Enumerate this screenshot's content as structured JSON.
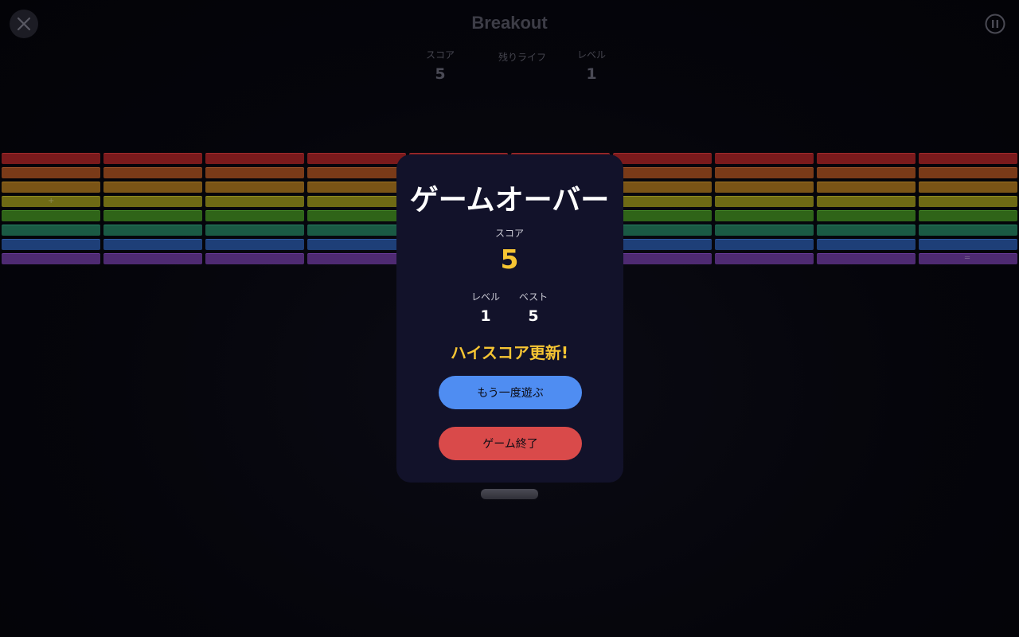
{
  "header": {
    "title": "Breakout",
    "close_icon": "close-icon",
    "pause_icon": "pause-icon"
  },
  "stats": {
    "score_label": "スコア",
    "score_value": "5",
    "lives_label": "残りライフ",
    "level_label": "レベル",
    "level_value": "1"
  },
  "bricks": {
    "columns": 10,
    "row_colors": [
      "#7a1a1c",
      "#7a3a18",
      "#7a5416",
      "#6e6a14",
      "#2f6418",
      "#1a5a44",
      "#1e3f78",
      "#4e2a72"
    ],
    "row_borders": [
      "#a02a2c",
      "#a05428",
      "#a07422",
      "#908c22",
      "#448a26",
      "#268060",
      "#2e5aa6",
      "#6c3c9e"
    ],
    "power_marks": [
      {
        "row": 3,
        "col": 0,
        "glyph": "+"
      },
      {
        "row": 7,
        "col": 9,
        "glyph": "═"
      }
    ]
  },
  "modal": {
    "title": "ゲームオーバー",
    "score_label": "スコア",
    "score_value": "5",
    "level_label": "レベル",
    "level_value": "1",
    "best_label": "ベスト",
    "best_value": "5",
    "highscore_text": "ハイスコア更新!",
    "play_again_label": "もう一度遊ぶ",
    "quit_label": "ゲーム終了"
  },
  "colors": {
    "accent_yellow": "#f6c533",
    "play_button": "#4f8df2",
    "quit_button": "#d94a4a",
    "modal_bg": "#12122a"
  }
}
